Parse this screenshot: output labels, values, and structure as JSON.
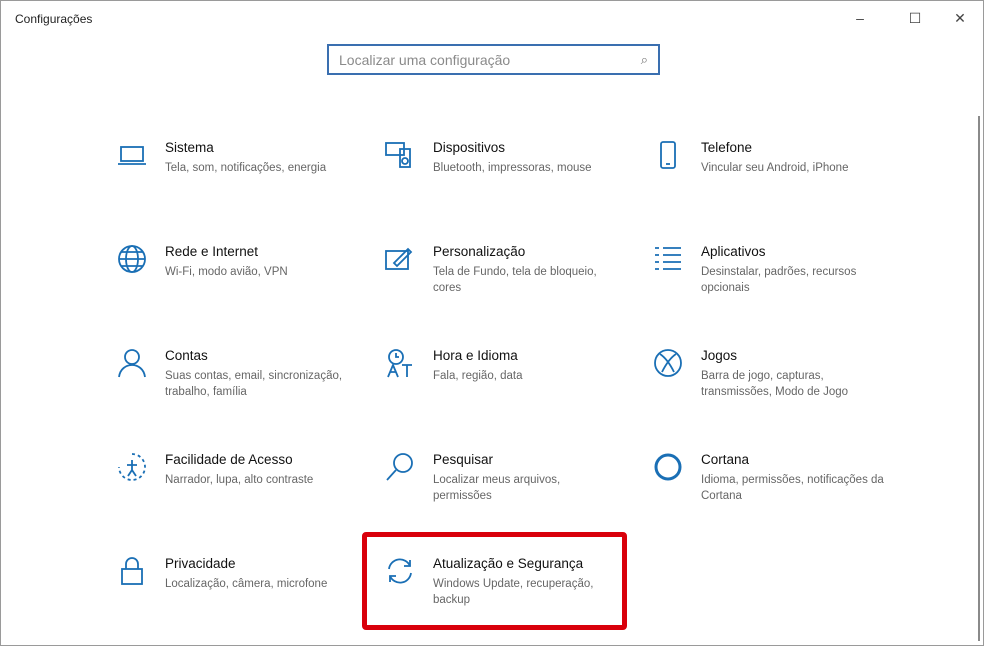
{
  "window": {
    "title": "Configurações",
    "minimize": "–",
    "maximize": "☐",
    "close": "✕"
  },
  "search": {
    "placeholder": "Localizar uma configuração",
    "icon": "search-icon"
  },
  "accent": "#1a6fb5",
  "highlight_color": "#d9000b",
  "items": [
    {
      "id": "sistema",
      "title": "Sistema",
      "desc": "Tela, som, notificações, energia",
      "icon": "laptop-icon"
    },
    {
      "id": "dispositivos",
      "title": "Dispositivos",
      "desc": "Bluetooth, impressoras, mouse",
      "icon": "devices-icon"
    },
    {
      "id": "telefone",
      "title": "Telefone",
      "desc": "Vincular seu Android, iPhone",
      "icon": "phone-icon"
    },
    {
      "id": "rede",
      "title": "Rede e Internet",
      "desc": "Wi-Fi, modo avião, VPN",
      "icon": "globe-icon"
    },
    {
      "id": "personalizacao",
      "title": "Personalização",
      "desc": "Tela de Fundo, tela de bloqueio, cores",
      "icon": "paint-icon"
    },
    {
      "id": "aplicativos",
      "title": "Aplicativos",
      "desc": "Desinstalar, padrões, recursos opcionais",
      "icon": "apps-list-icon"
    },
    {
      "id": "contas",
      "title": "Contas",
      "desc": "Suas contas, email, sincronização, trabalho, família",
      "icon": "person-icon"
    },
    {
      "id": "hora",
      "title": "Hora e Idioma",
      "desc": "Fala, região, data",
      "icon": "time-language-icon"
    },
    {
      "id": "jogos",
      "title": "Jogos",
      "desc": "Barra de jogo, capturas, transmissões, Modo de Jogo",
      "icon": "xbox-icon"
    },
    {
      "id": "facilidade",
      "title": "Facilidade de Acesso",
      "desc": "Narrador, lupa, alto contraste",
      "icon": "ease-of-access-icon"
    },
    {
      "id": "pesquisar",
      "title": "Pesquisar",
      "desc": "Localizar meus arquivos, permissões",
      "icon": "search-icon"
    },
    {
      "id": "cortana",
      "title": "Cortana",
      "desc": "Idioma, permissões, notificações da Cortana",
      "icon": "cortana-icon"
    },
    {
      "id": "privacidade",
      "title": "Privacidade",
      "desc": "Localização, câmera, microfone",
      "icon": "lock-icon"
    },
    {
      "id": "atualizacao",
      "title": "Atualização e Segurança",
      "desc": "Windows Update, recuperação, backup",
      "icon": "sync-icon"
    }
  ]
}
